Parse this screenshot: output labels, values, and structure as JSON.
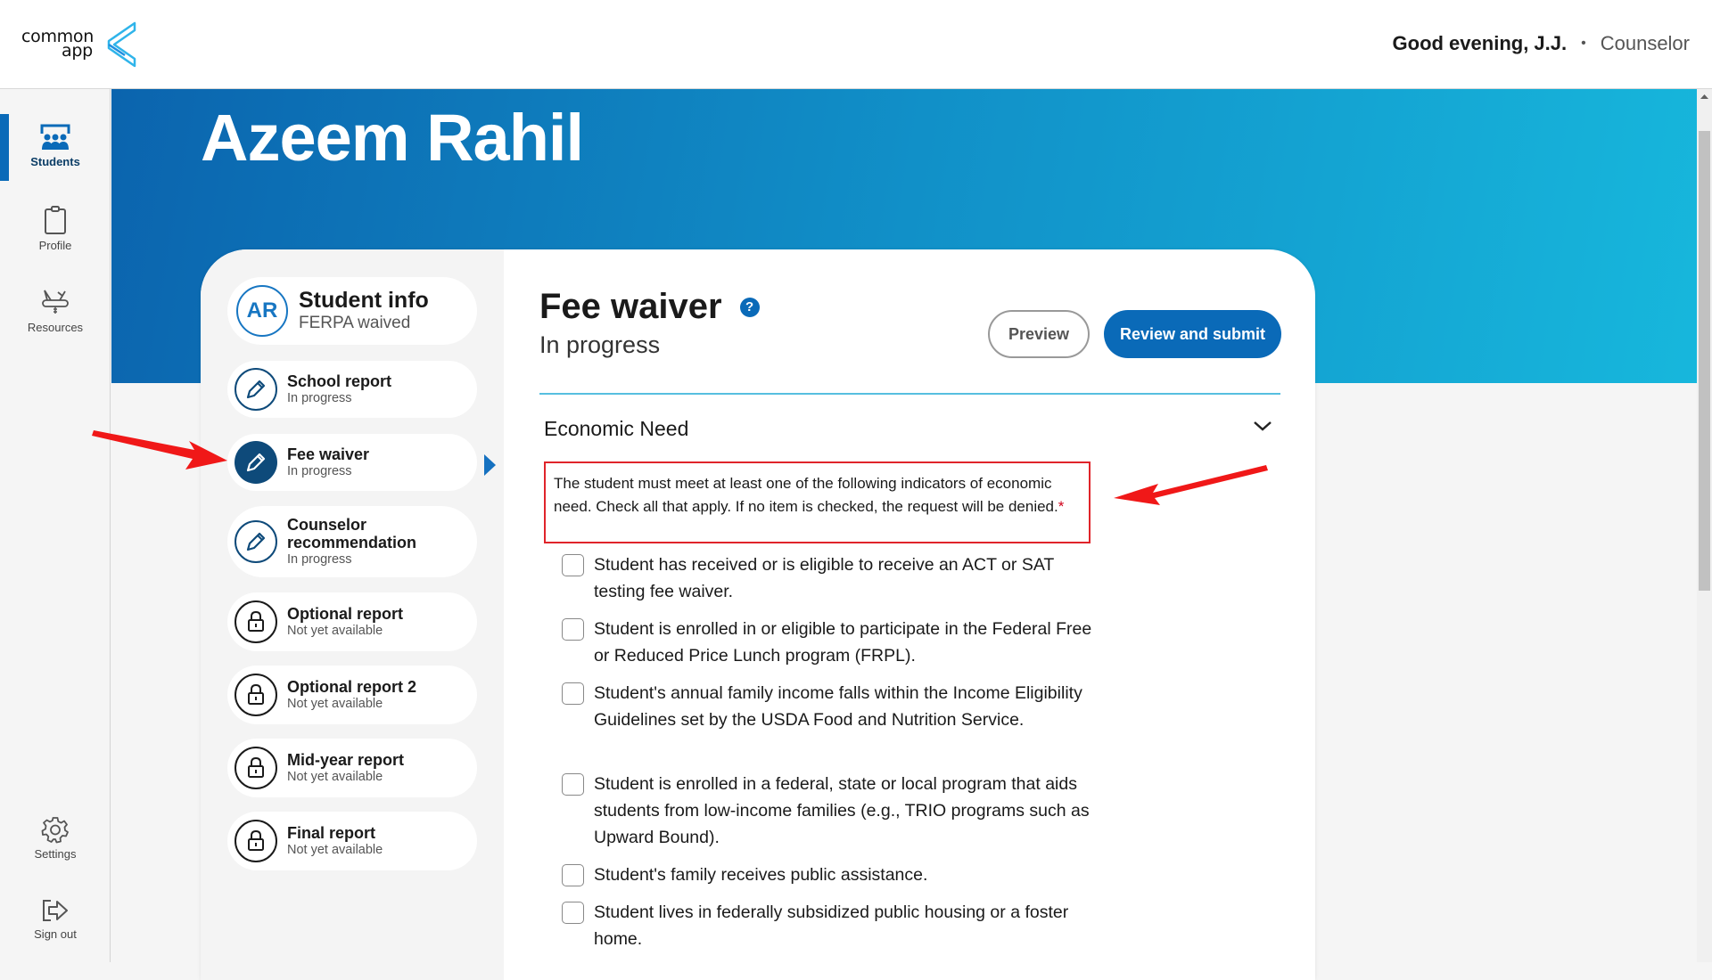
{
  "header": {
    "logo_line1": "common",
    "logo_line2": "app",
    "greeting": "Good evening, J.J.",
    "separator": "•",
    "role": "Counselor"
  },
  "nav": {
    "items": [
      {
        "label": "Students",
        "icon": "students-icon",
        "active": true
      },
      {
        "label": "Profile",
        "icon": "clipboard-icon",
        "active": false
      },
      {
        "label": "Resources",
        "icon": "swiss-army-knife-icon",
        "active": false
      }
    ],
    "bottom": [
      {
        "label": "Settings",
        "icon": "gear-icon"
      },
      {
        "label": "Sign out",
        "icon": "sign-out-icon"
      }
    ]
  },
  "student": {
    "name": "Azeem Rahil",
    "initials": "AR"
  },
  "steps": [
    {
      "title": "Student info",
      "subtitle": "FERPA waived",
      "icon": "avatar"
    },
    {
      "title": "School report",
      "subtitle": "In progress",
      "icon": "pencil-icon"
    },
    {
      "title": "Fee waiver",
      "subtitle": "In progress",
      "icon": "pencil-icon",
      "selected": true
    },
    {
      "title": "Counselor recommendation",
      "subtitle": "In progress",
      "icon": "pencil-icon"
    },
    {
      "title": "Optional report",
      "subtitle": "Not yet available",
      "icon": "lock-icon"
    },
    {
      "title": "Optional report 2",
      "subtitle": "Not yet available",
      "icon": "lock-icon"
    },
    {
      "title": "Mid-year report",
      "subtitle": "Not yet available",
      "icon": "lock-icon"
    },
    {
      "title": "Final report",
      "subtitle": "Not yet available",
      "icon": "lock-icon"
    }
  ],
  "form": {
    "title": "Fee waiver",
    "help_glyph": "?",
    "status": "In progress",
    "preview_label": "Preview",
    "submit_label": "Review and submit",
    "section_title": "Economic Need",
    "instructions": "The student must meet at least one of the following indicators of economic need. Check all that apply. If no item is checked, the request will be denied.",
    "required_mark": "*",
    "options": [
      {
        "label": "Student has received or is eligible to receive an ACT or SAT testing fee waiver.",
        "checked": false
      },
      {
        "label": "Student is enrolled in or eligible to participate in the Federal Free or Reduced Price Lunch program (FRPL).",
        "checked": false
      },
      {
        "label": "Student's annual family income falls within the Income Eligibility Guidelines set by the USDA Food and Nutrition Service.",
        "checked": false
      },
      {
        "label": "Student is enrolled in a federal, state or local program that aids students from low-income families (e.g., TRIO programs such as Upward Bound).",
        "checked": false
      },
      {
        "label": "Student's family receives public assistance.",
        "checked": false
      },
      {
        "label": "Student lives in federally subsidized public housing or a foster home.",
        "checked": false
      }
    ]
  },
  "colors": {
    "brand_blue": "#0a6ab8",
    "dark_navy": "#0e4a7a",
    "annotation_red": "#e0242a"
  }
}
